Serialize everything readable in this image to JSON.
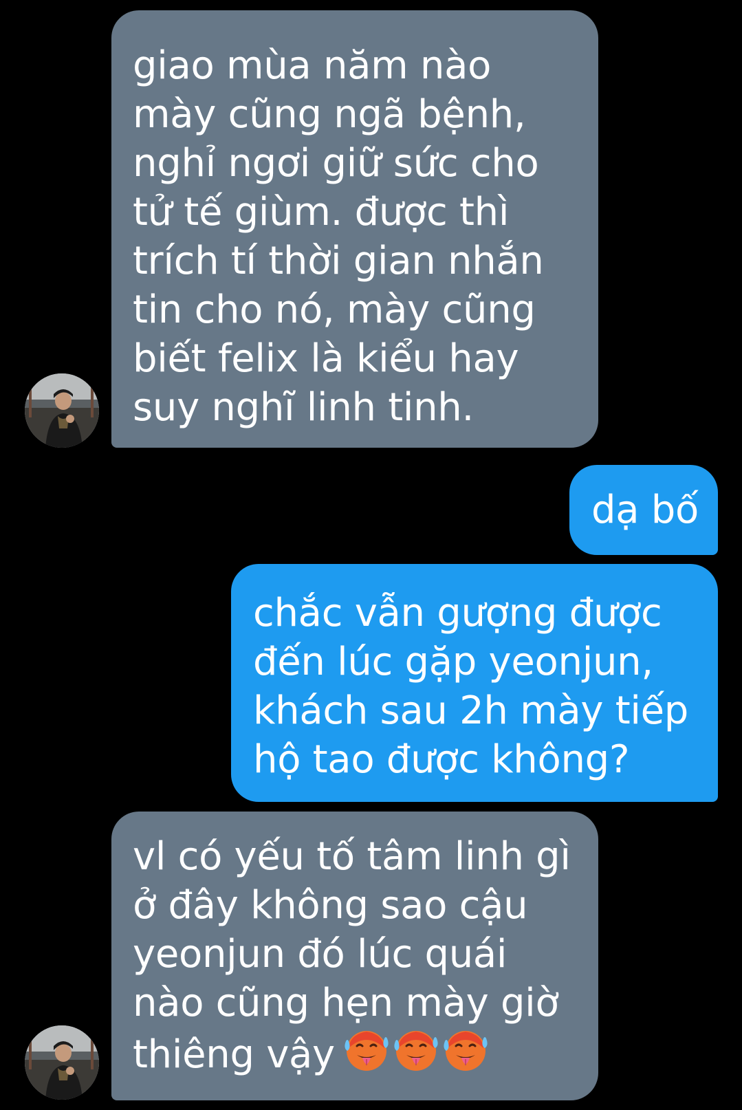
{
  "conversation": {
    "messages": [
      {
        "sender": "other",
        "lines": [
          "giao mùa năm nào",
          "mày cũng ngã bệnh,",
          "nghỉ ngơi giữ sức cho",
          "tử tế giùm. được thì",
          "trích tí thời gian nhắn",
          "tin cho nó, mày cũng",
          "biết felix là kiểu hay",
          "suy nghĩ linh tinh."
        ]
      },
      {
        "sender": "me",
        "lines": [
          "dạ bố"
        ]
      },
      {
        "sender": "me",
        "lines": [
          "chắc vẫn gượng được",
          "đến lúc gặp yeonjun,",
          "khách sau 2h mày tiếp",
          "hộ tao được không?"
        ]
      },
      {
        "sender": "other",
        "lines": [
          "vl có yếu tố tâm linh gì",
          "ở đây không sao cậu",
          "yeonjun đó lúc quái",
          "nào cũng hẹn mày giờ",
          "thiêng vậy"
        ],
        "trailing_emoji": [
          "hot-face-emoji",
          "hot-face-emoji",
          "hot-face-emoji"
        ]
      }
    ]
  },
  "colors": {
    "background": "#000000",
    "incoming_bubble": "#677888",
    "outgoing_bubble": "#1e9bf0",
    "text": "#ffffff"
  }
}
